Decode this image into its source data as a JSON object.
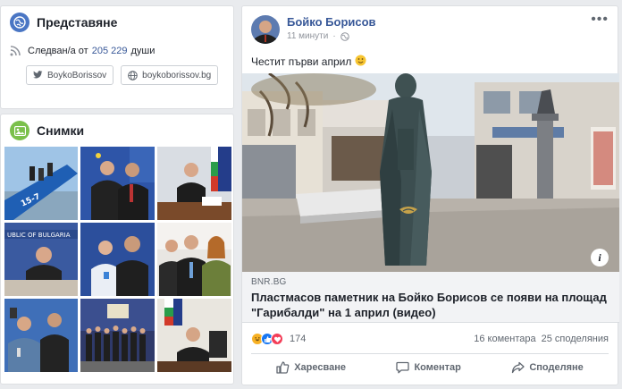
{
  "intro": {
    "title": "Представяне",
    "followers_prefix": "Следван/а от",
    "followers_count": "205 229",
    "followers_suffix": "души",
    "links": [
      {
        "icon": "twitter-icon",
        "label": "BoykoBorissov"
      },
      {
        "icon": "globe-icon",
        "label": "boykoborissov.bg"
      }
    ]
  },
  "photos": {
    "title": "Снимки",
    "items": [
      {
        "scene": "airplane-stairs"
      },
      {
        "scene": "handshake-flags"
      },
      {
        "scene": "desk-signing"
      },
      {
        "scene": "council-podium"
      },
      {
        "scene": "group-meeting"
      },
      {
        "scene": "three-people"
      },
      {
        "scene": "selfie-crowd"
      },
      {
        "scene": "stage-group"
      },
      {
        "scene": "office-flag"
      }
    ]
  },
  "post": {
    "author": "Бойко Борисов",
    "time": "11 минути",
    "privacy_icon": "globe-icon",
    "text": "Честит първи април",
    "emoji": "smile-icon",
    "link": {
      "domain": "BNR.BG",
      "title": "Пластмасов паметник на Бойко Борисов се появи на площад \"Гарибалди\" на 1 април (видео)"
    },
    "reactions": {
      "count": "174",
      "types": [
        "haha",
        "like",
        "love"
      ]
    },
    "comments": "16 коментара",
    "shares": "25 споделяния",
    "actions": {
      "like": "Харесване",
      "comment": "Коментар",
      "share": "Споделяне"
    }
  },
  "colors": {
    "link_blue": "#385898",
    "page_bg": "#e9ebee",
    "reaction_like": "#1877f2",
    "reaction_love": "#f33e58",
    "reaction_haha": "#f7b125"
  }
}
